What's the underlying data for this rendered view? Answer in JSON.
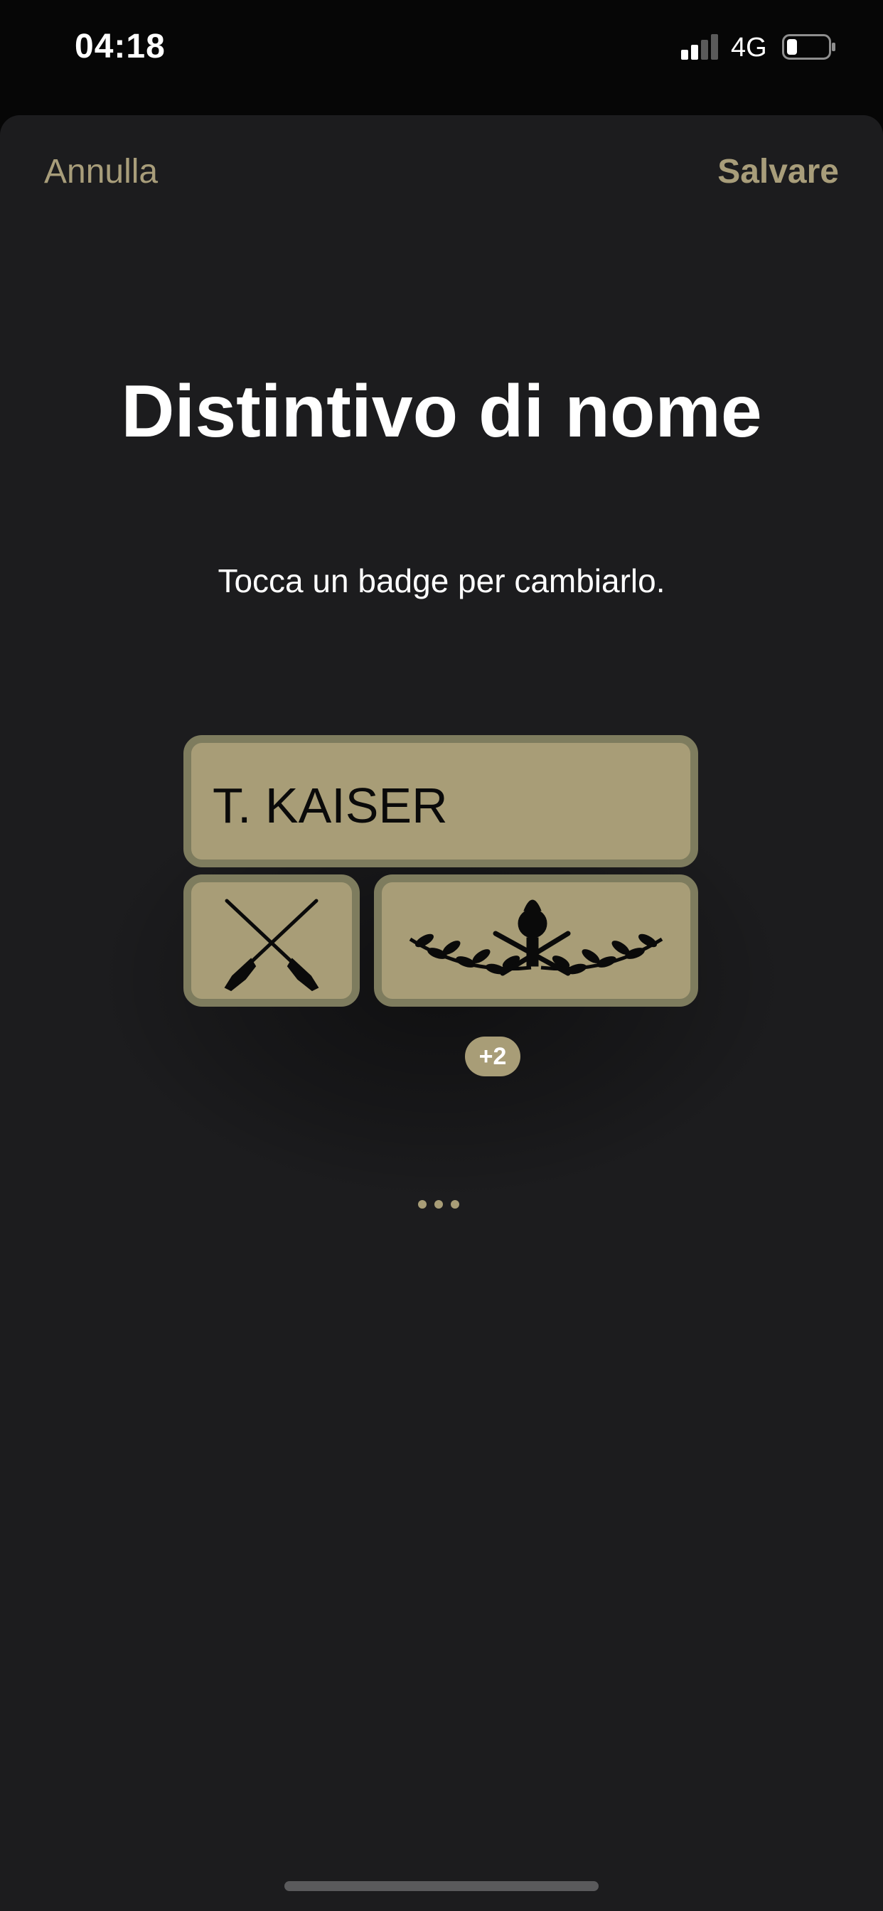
{
  "status_bar": {
    "time": "04:18",
    "network": "4G",
    "icons": [
      "signal-icon",
      "battery-icon"
    ]
  },
  "nav": {
    "cancel_label": "Annulla",
    "save_label": "Salvare"
  },
  "title": "Distintivo di nome",
  "subtitle": "Tocca un badge per cambiarlo.",
  "badges": {
    "name_text": "T. KAISER",
    "icons": [
      "crossed-rifles-icon",
      "laurel-emblem-icon"
    ],
    "more_count": "+2"
  },
  "colors": {
    "accent": "#a89d7a",
    "badge_fill": "#a89d77",
    "badge_border": "#7e7c5e",
    "sheet_background": "#1c1c1e"
  }
}
